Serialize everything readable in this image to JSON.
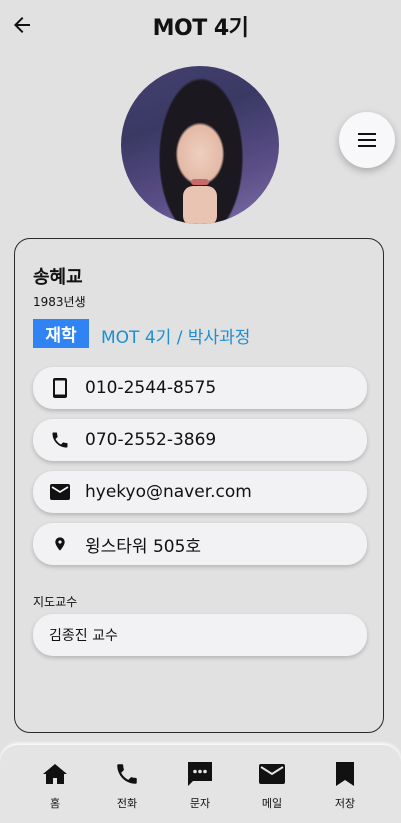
{
  "header": {
    "title": "MOT 4기"
  },
  "profile": {
    "name": "송혜교",
    "birth": "1983년생",
    "status": "재학",
    "program": "MOT 4기 / 박사과정"
  },
  "contacts": {
    "mobile": "010-2544-8575",
    "phone": "070-2552-3869",
    "email": "hyekyo@naver.com",
    "location": "윙스타워 505호"
  },
  "advisor": {
    "label": "지도교수",
    "value": "김종진 교수"
  },
  "nav": {
    "items": [
      {
        "label": "홈",
        "icon": "home-icon"
      },
      {
        "label": "전화",
        "icon": "phone-icon"
      },
      {
        "label": "문자",
        "icon": "message-icon"
      },
      {
        "label": "메일",
        "icon": "mail-icon"
      },
      {
        "label": "저장",
        "icon": "bookmark-icon"
      }
    ]
  },
  "colors": {
    "status_badge": "#2f83f2",
    "program_text": "#1a8fd6",
    "background": "#e1e1e1"
  }
}
